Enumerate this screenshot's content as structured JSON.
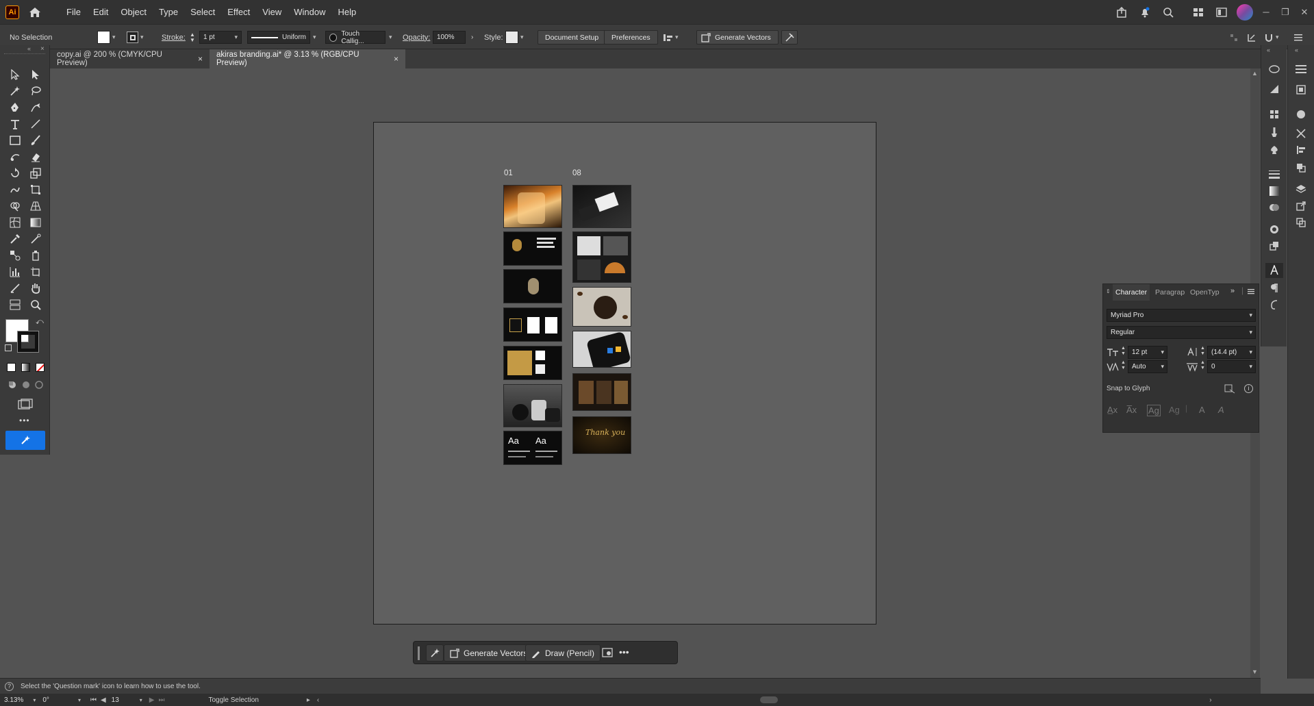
{
  "app": {
    "logo": "Ai"
  },
  "menu": [
    "File",
    "Edit",
    "Object",
    "Type",
    "Select",
    "Effect",
    "View",
    "Window",
    "Help"
  ],
  "control": {
    "selection": "No Selection",
    "stroke_label": "Stroke:",
    "stroke_weight": "1 pt",
    "profile": "Uniform",
    "brush": "Touch Callig...",
    "opacity_label": "Opacity:",
    "opacity": "100%",
    "style_label": "Style:",
    "document_setup": "Document Setup",
    "preferences": "Preferences",
    "generate_vectors": "Generate Vectors"
  },
  "tabs": [
    {
      "label": "copy.ai @ 200 % (CMYK/CPU Preview)",
      "close": "×"
    },
    {
      "label": "akiras branding.ai* @ 3.13 % (RGB/CPU Preview)",
      "close": "×"
    }
  ],
  "toolbar": {
    "more": "•••"
  },
  "artboard": {
    "col1_label": "01",
    "col2_label": "08",
    "thumb_text": {
      "aa1": "Aa",
      "aa2": "Aa",
      "thanks": "Thank you"
    }
  },
  "character_panel": {
    "tabs": [
      "Character",
      "Paragrap",
      "OpenTyp"
    ],
    "font_family": "Myriad Pro",
    "font_style": "Regular",
    "font_size": "12 pt",
    "leading": "(14.4 pt)",
    "kerning": "Auto",
    "tracking": "0",
    "snap_to_glyph": "Snap to Glyph"
  },
  "taskbar": {
    "generate_vectors": "Generate Vectors",
    "draw": "Draw (Pencil)"
  },
  "status": {
    "hint": "Select the 'Question mark' icon to learn how to use the tool.",
    "zoom": "3.13%",
    "rotation": "0°",
    "artboard_num": "13",
    "toggle": "Toggle Selection"
  },
  "colors": {
    "accent": "#1473e6",
    "chrome": "#323232",
    "canvas": "#535353",
    "artboard": "#606060"
  }
}
